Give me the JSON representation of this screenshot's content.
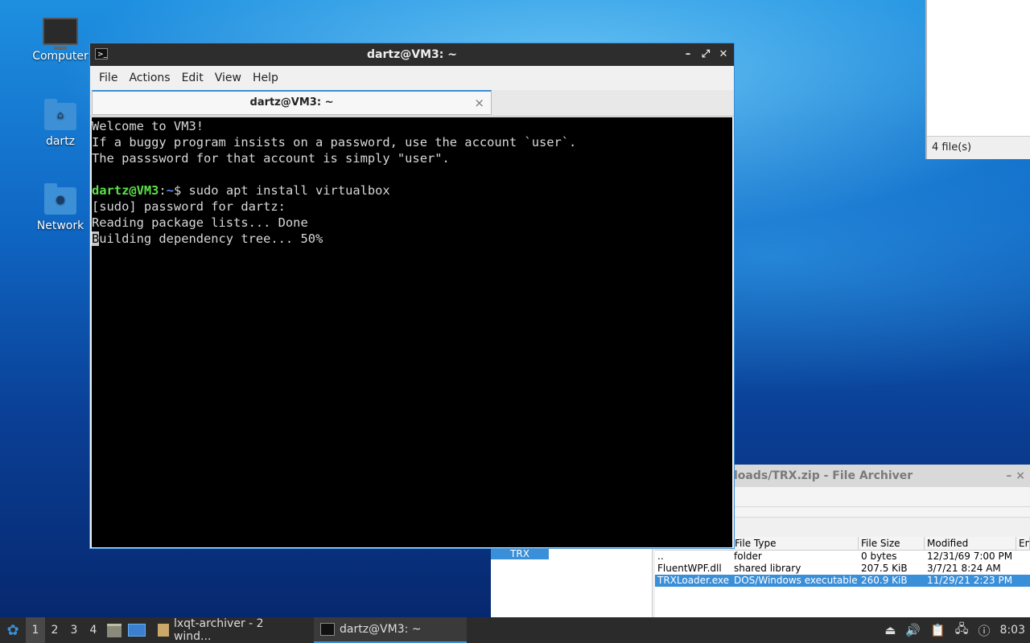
{
  "desktop": {
    "icons": [
      {
        "label": "Computer",
        "icon": "computer-icon"
      },
      {
        "label": "dartz",
        "icon": "home-folder-icon"
      },
      {
        "label": "Network",
        "icon": "network-folder-icon"
      }
    ]
  },
  "file_manager": {
    "status": "4 file(s)"
  },
  "archiver": {
    "title": "loads/TRX.zip - File Archiver",
    "tree_selected": "TRX",
    "columns": [
      "File Type",
      "File Size",
      "Modified",
      "En"
    ],
    "rows": [
      {
        "name": "..",
        "type": "folder",
        "size": "0 bytes",
        "modified": "12/31/69 7:00 PM"
      },
      {
        "name": "FluentWPF.dll",
        "type": "shared library",
        "size": "207.5 KiB",
        "modified": "3/7/21 8:24 AM"
      },
      {
        "name": "TRXLoader.exe",
        "type": "DOS/Windows executable",
        "size": "260.9 KiB",
        "modified": "11/29/21 2:23 PM",
        "selected": true
      }
    ]
  },
  "terminal": {
    "title": "dartz@VM3: ~",
    "menu": [
      "File",
      "Actions",
      "Edit",
      "View",
      "Help"
    ],
    "tab_title": "dartz@VM3: ~",
    "lines": {
      "l1": "Welcome to VM3!",
      "l2": "If a buggy program insists on a password, use the account `user`.",
      "l3": "The passsword for that account is simply \"user\".",
      "prompt_user": "dartz@VM3",
      "prompt_sep": ":",
      "prompt_path": "~",
      "prompt_cmd": "$ sudo apt install virtualbox",
      "l5": "[sudo] password for dartz:",
      "l6": "Reading package lists... Done",
      "l7_cursor": "B",
      "l7_rest": "uilding dependency tree... 50%"
    }
  },
  "taskbar": {
    "workspaces": [
      "1",
      "2",
      "3",
      "4"
    ],
    "tasks": [
      {
        "label": "lxqt-archiver - 2 wind...",
        "icon": "archive-icon"
      },
      {
        "label": "dartz@VM3: ~",
        "icon": "terminal-icon"
      }
    ],
    "clock": "8:03"
  },
  "colors": {
    "accent": "#3a8fd9",
    "prompt_user": "#5de04a",
    "prompt_path": "#5b8ef5"
  }
}
